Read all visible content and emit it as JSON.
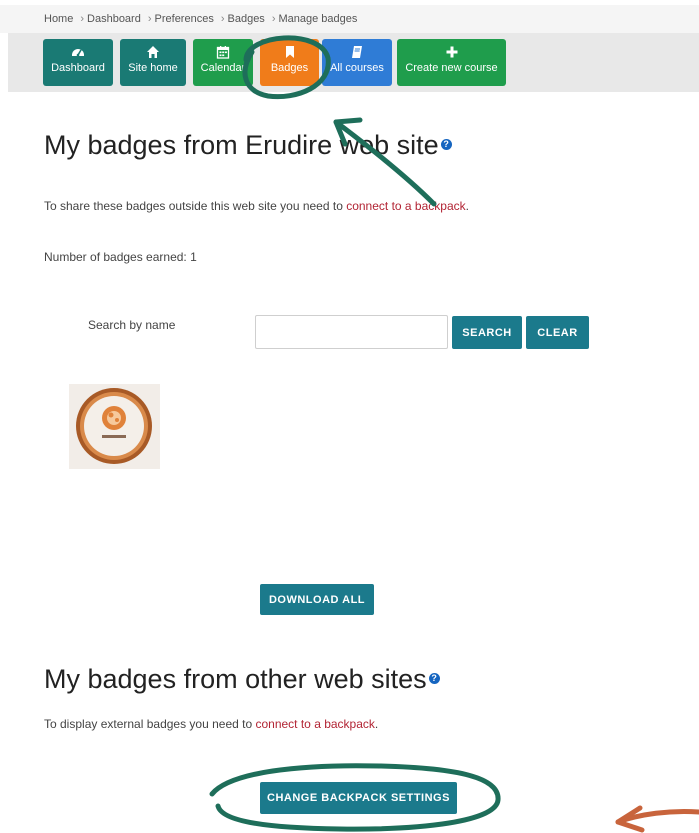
{
  "breadcrumb": {
    "items": [
      "Home",
      "Dashboard",
      "Preferences",
      "Badges",
      "Manage badges"
    ]
  },
  "nav": {
    "items": [
      {
        "label": "Dashboard",
        "icon": "dashboard-icon",
        "color": "#1a7a74"
      },
      {
        "label": "Site home",
        "icon": "home-icon",
        "color": "#1a7a74"
      },
      {
        "label": "Calendar",
        "icon": "calendar-icon",
        "color": "#1f9d4c"
      },
      {
        "label": "Badges",
        "icon": "bookmark-icon",
        "color": "#f07c1a"
      },
      {
        "label": "All courses",
        "icon": "book-icon",
        "color": "#2f7cd6"
      },
      {
        "label": "Create new course",
        "icon": "plus-icon",
        "color": "#1f9d4c"
      }
    ]
  },
  "main": {
    "title": "My badges from Erudire web site",
    "share_text": "To share these badges outside this web site you need to ",
    "share_link": "connect to a backpack",
    "share_end": ".",
    "earned_text": "Number of badges earned: 1",
    "search_label": "Search by name",
    "search_value": "",
    "search_button": "SEARCH",
    "clear_button": "CLEAR",
    "download_button": "DOWNLOAD ALL"
  },
  "external": {
    "title": "My badges from other web sites",
    "display_text": "To display external badges you need to ",
    "display_link": "connect to a backpack",
    "display_end": ".",
    "change_button": "CHANGE BACKPACK SETTINGS"
  },
  "colors": {
    "annotation": "#1e6e5a",
    "annotation_orange": "#c8643c",
    "link": "#b22434",
    "button": "#1b7a8c"
  }
}
